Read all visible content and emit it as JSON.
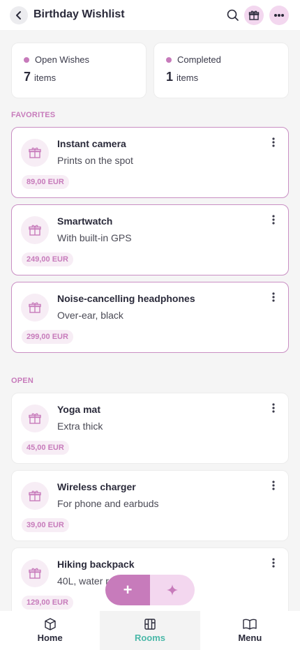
{
  "header": {
    "title": "Birthday Wishlist",
    "icons": [
      "chevron-left-icon",
      "search-icon",
      "gift-box-icon",
      "more-horizontal-icon"
    ]
  },
  "stats": {
    "open": {
      "label": "Open Wishes",
      "count": "7",
      "unit": "items"
    },
    "completed": {
      "label": "Completed",
      "count": "1",
      "unit": "items"
    }
  },
  "sections": {
    "favorites": "FAVORITES",
    "open": "OPEN"
  },
  "favorites": [
    {
      "title": "Instant camera",
      "desc": "Prints on the spot",
      "price": "89,00 EUR"
    },
    {
      "title": "Smartwatch",
      "desc": "With built-in GPS",
      "price": "249,00 EUR"
    },
    {
      "title": "Noise-cancelling headphones",
      "desc": "Over-ear, black",
      "price": "299,00 EUR"
    }
  ],
  "open_items": [
    {
      "title": "Yoga mat",
      "desc": "Extra thick",
      "price": "45,00 EUR"
    },
    {
      "title": "Wireless charger",
      "desc": "For phone and earbuds",
      "price": "39,00 EUR"
    },
    {
      "title": "Hiking backpack",
      "desc": "40L, water r",
      "price": "129,00 EUR"
    }
  ],
  "fab": {
    "add_label": "+"
  },
  "nav": [
    {
      "label": "Home",
      "icon": "cube-icon",
      "active": false
    },
    {
      "label": "Rooms",
      "icon": "map-icon",
      "active": true
    },
    {
      "label": "Menu",
      "icon": "book-icon",
      "active": false
    }
  ],
  "colors": {
    "accent": "#c77bbb",
    "accent_light": "#f3d7ef",
    "nav_active": "#4ab8a8"
  }
}
